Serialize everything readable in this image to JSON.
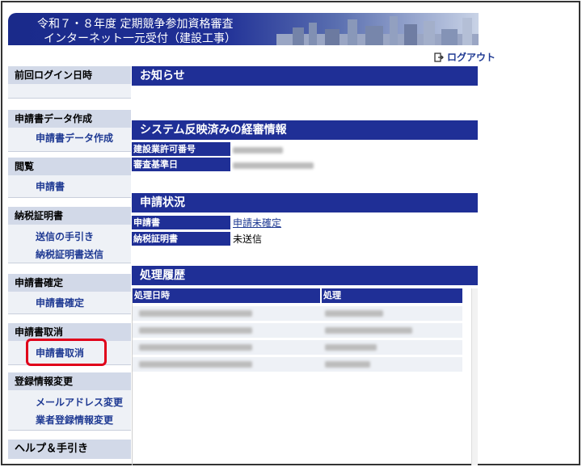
{
  "header": {
    "line1": "令和７・８年度 定期競争参加資格審査",
    "line2": "インターネット一元受付（建設工事）"
  },
  "logout": {
    "label": "ログアウト",
    "icon": "logout-icon"
  },
  "sidebar": {
    "last_login": {
      "heading": "前回ログイン日時"
    },
    "create": {
      "heading": "申請書データ作成",
      "links": [
        "申請書データ作成"
      ]
    },
    "view": {
      "heading": "閲覧",
      "links": [
        "申請書"
      ]
    },
    "tax": {
      "heading": "納税証明書",
      "links": [
        "送信の手引き",
        "納税証明書送信"
      ]
    },
    "confirm": {
      "heading": "申請書確定",
      "links": [
        "申請書確定"
      ]
    },
    "cancel": {
      "heading": "申請書取消",
      "links": [
        "申請書取消"
      ]
    },
    "change": {
      "heading": "登録情報変更",
      "links": [
        "メールアドレス変更",
        "業者登録情報変更"
      ]
    },
    "help": {
      "heading": "ヘルプ＆手引き"
    }
  },
  "notice": {
    "heading": "お知らせ"
  },
  "business": {
    "heading": "システム反映済みの経審情報",
    "rows": [
      {
        "label": "建設業許可番号"
      },
      {
        "label": "審査基準日"
      }
    ]
  },
  "status": {
    "heading": "申請状況",
    "rows": [
      {
        "label": "申請書",
        "value": "申請未確定"
      },
      {
        "label": "納税証明書",
        "value": "未送信"
      }
    ]
  },
  "history": {
    "heading": "処理履歴",
    "columns": [
      "処理日時",
      "処理"
    ]
  },
  "colors": {
    "accent": "#1f2f96",
    "highlight": "#e0001a",
    "link": "#1f3a93"
  }
}
